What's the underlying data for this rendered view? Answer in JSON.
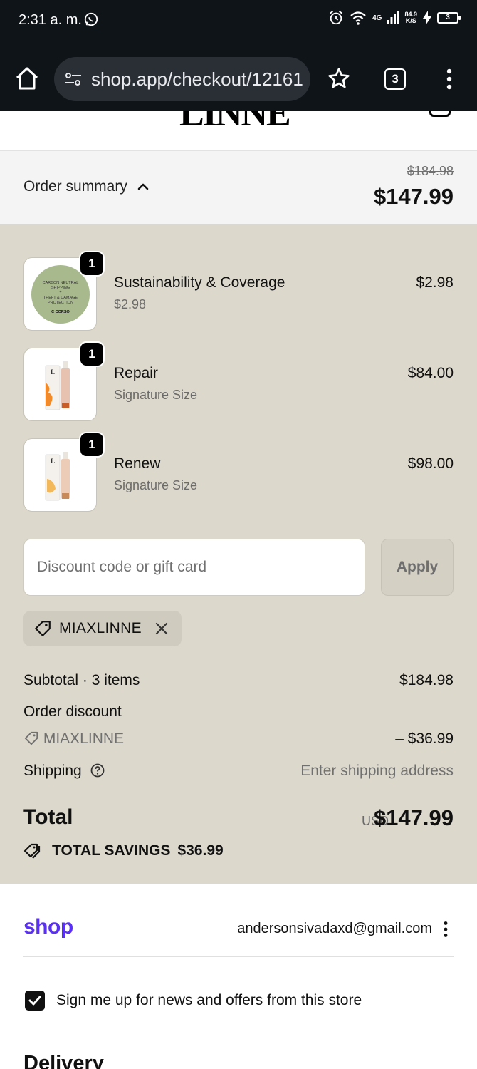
{
  "status_bar": {
    "time": "2:31 a. m.",
    "network": "4G",
    "speed_value": "84.9",
    "speed_unit": "K/S",
    "battery": "3"
  },
  "browser": {
    "url": "shop.app/checkout/12161",
    "tab_count": "3"
  },
  "store": {
    "logo_text": "LINNE"
  },
  "summary_bar": {
    "label": "Order summary",
    "original_total": "$184.98",
    "total": "$147.99"
  },
  "items": [
    {
      "name": "Sustainability & Coverage",
      "subtitle": "$2.98",
      "price": "$2.98",
      "quantity": "1",
      "thumb_text": [
        "CARBON NEUTRAL",
        "SHIPPING",
        "+",
        "THEFT & DAMAGE",
        "PROTECTION",
        "C CORSO"
      ]
    },
    {
      "name": "Repair",
      "subtitle": "Signature Size",
      "price": "$84.00",
      "quantity": "1"
    },
    {
      "name": "Renew",
      "subtitle": "Signature Size",
      "price": "$98.00",
      "quantity": "1"
    }
  ],
  "discount": {
    "placeholder": "Discount code or gift card",
    "apply_label": "Apply",
    "applied_code": "MIAXLINNE"
  },
  "totals": {
    "subtotal_label": "Subtotal · 3 items",
    "subtotal_value": "$184.98",
    "discount_label": "Order discount",
    "discount_code": "MIAXLINNE",
    "discount_value": "– $36.99",
    "shipping_label": "Shipping",
    "shipping_value": "Enter shipping address",
    "total_label": "Total",
    "currency": "USD",
    "total_value": "$147.99",
    "savings_label": "TOTAL SAVINGS",
    "savings_value": "$36.99"
  },
  "account": {
    "shop_logo": "shop",
    "email": "andersonsivadaxd@gmail.com"
  },
  "newsletter": {
    "label": "Sign me up for news and offers from this store",
    "checked": true
  },
  "delivery": {
    "heading": "Delivery"
  },
  "colors": {
    "panel_bg": "#dcd8cc",
    "shop_purple": "#5a31f4",
    "status_bg": "#0f1419"
  }
}
